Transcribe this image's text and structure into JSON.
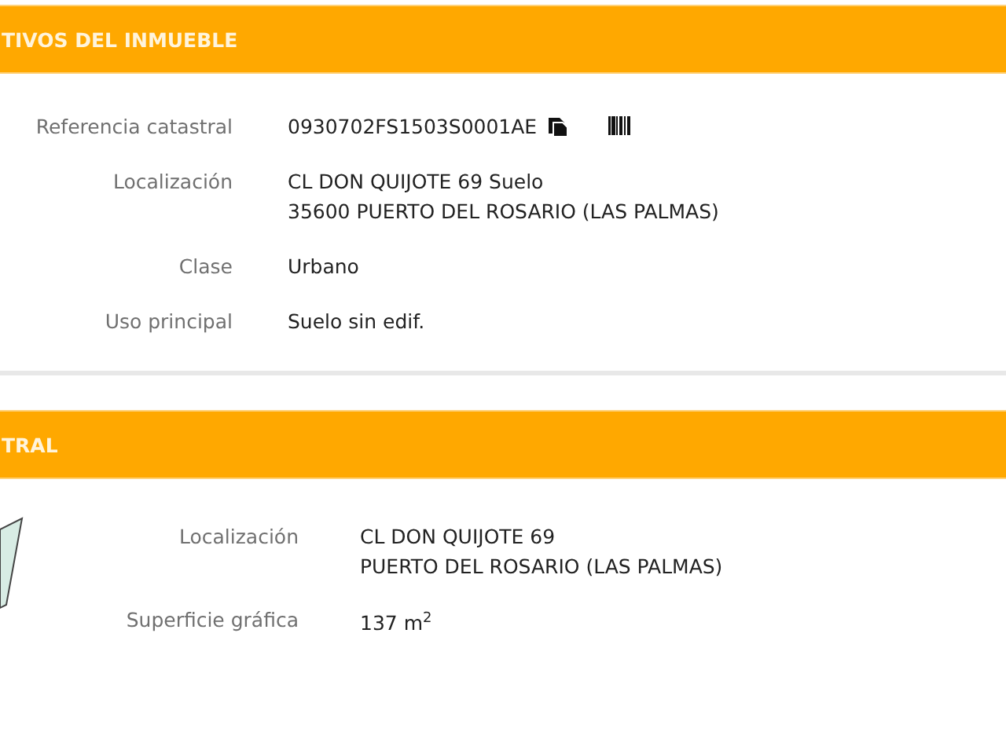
{
  "sections": [
    {
      "title": "TIVOS DEL INMUEBLE",
      "kind": "details",
      "fields": [
        {
          "label": "Referencia catastral",
          "lines": [
            "0930702FS1503S0001AE"
          ],
          "actions": [
            {
              "kind": "copy"
            },
            {
              "kind": "barcode"
            }
          ]
        },
        {
          "label": "Localización",
          "lines": [
            "CL DON QUIJOTE 69 Suelo",
            "35600 PUERTO DEL ROSARIO (LAS PALMAS)"
          ]
        },
        {
          "label": "Clase",
          "lines": [
            "Urbano"
          ]
        },
        {
          "label": "Uso principal",
          "lines": [
            "Suelo sin edif."
          ]
        }
      ]
    },
    {
      "title": "TRAL",
      "kind": "parcel",
      "fields": [
        {
          "label": "Localización",
          "lines": [
            "CL DON QUIJOTE 69",
            "PUERTO DEL ROSARIO (LAS PALMAS)"
          ]
        },
        {
          "label": "Superficie gráfica",
          "lines": [
            "137 m$^{2}$"
          ]
        }
      ]
    }
  ]
}
